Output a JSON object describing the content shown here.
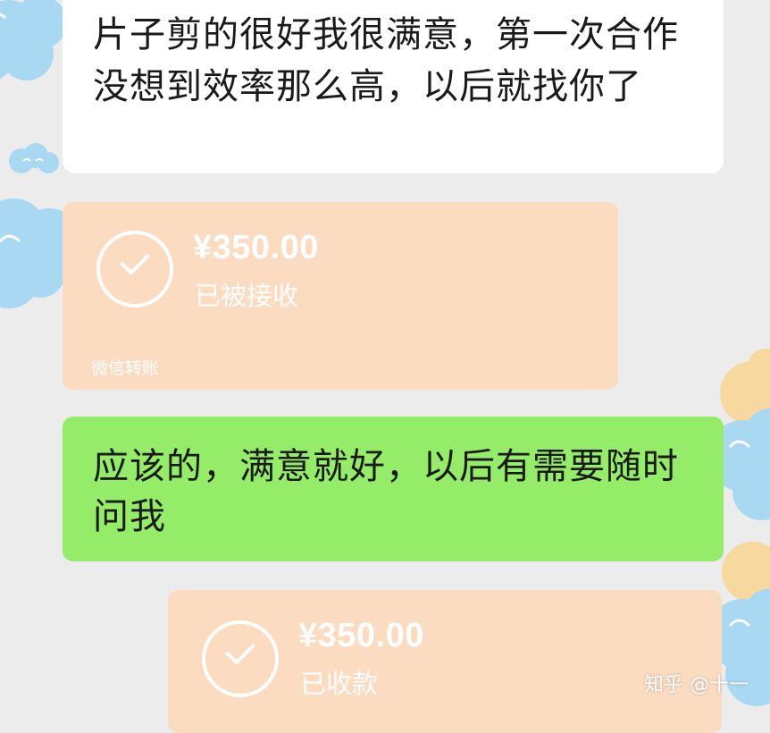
{
  "messages": [
    {
      "type": "text",
      "side": "left",
      "text": "片子剪的很好我很满意，第一次合作没想到效率那么高，以后就找你了"
    },
    {
      "type": "transfer",
      "amount": "¥350.00",
      "status": "已被接收",
      "service": "微信转账"
    },
    {
      "type": "text",
      "side": "right",
      "text": "应该的，满意就好，以后有需要随时问我"
    },
    {
      "type": "transfer",
      "amount": "¥350.00",
      "status": "已收款"
    }
  ],
  "watermark": "知乎 @十一",
  "colors": {
    "background": "#ececec",
    "white_bubble": "#ffffff",
    "green_bubble": "#95ec69",
    "transfer_bubble": "#fbdcc0",
    "cloud_sticker": "#a9d8f2"
  },
  "decorations": [
    "cloud-sticker-icon",
    "check-circle-icon"
  ]
}
